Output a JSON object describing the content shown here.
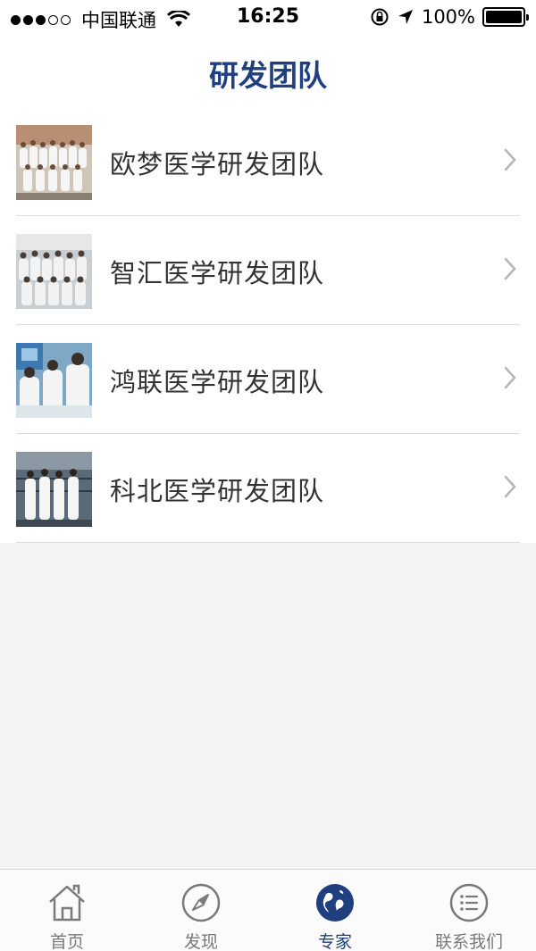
{
  "status_bar": {
    "carrier": "中国联通",
    "time": "16:25",
    "battery": "100%",
    "battery_level": 1.0,
    "signal_bars_filled": 3,
    "signal_bars_total": 5
  },
  "nav": {
    "title": "研发团队"
  },
  "list": {
    "items": [
      {
        "label": "欧梦医学研发团队",
        "thumb_icon": "team-photo-icon"
      },
      {
        "label": "智汇医学研发团队",
        "thumb_icon": "team-photo-icon"
      },
      {
        "label": "鸿联医学研发团队",
        "thumb_icon": "team-photo-icon"
      },
      {
        "label": "科北医学研发团队",
        "thumb_icon": "team-photo-icon"
      }
    ]
  },
  "tab_bar": {
    "tabs": [
      {
        "label": "首页",
        "icon": "home-icon",
        "active": false
      },
      {
        "label": "发现",
        "icon": "compass-icon",
        "active": false
      },
      {
        "label": "专家",
        "icon": "globe-icon",
        "active": true
      },
      {
        "label": "联系我们",
        "icon": "list-icon",
        "active": false
      }
    ]
  },
  "colors": {
    "accent": "#1f3f7f",
    "tab_inactive": "#7a7a7a",
    "list_text": "#333333",
    "background": "#f3f3f3"
  }
}
